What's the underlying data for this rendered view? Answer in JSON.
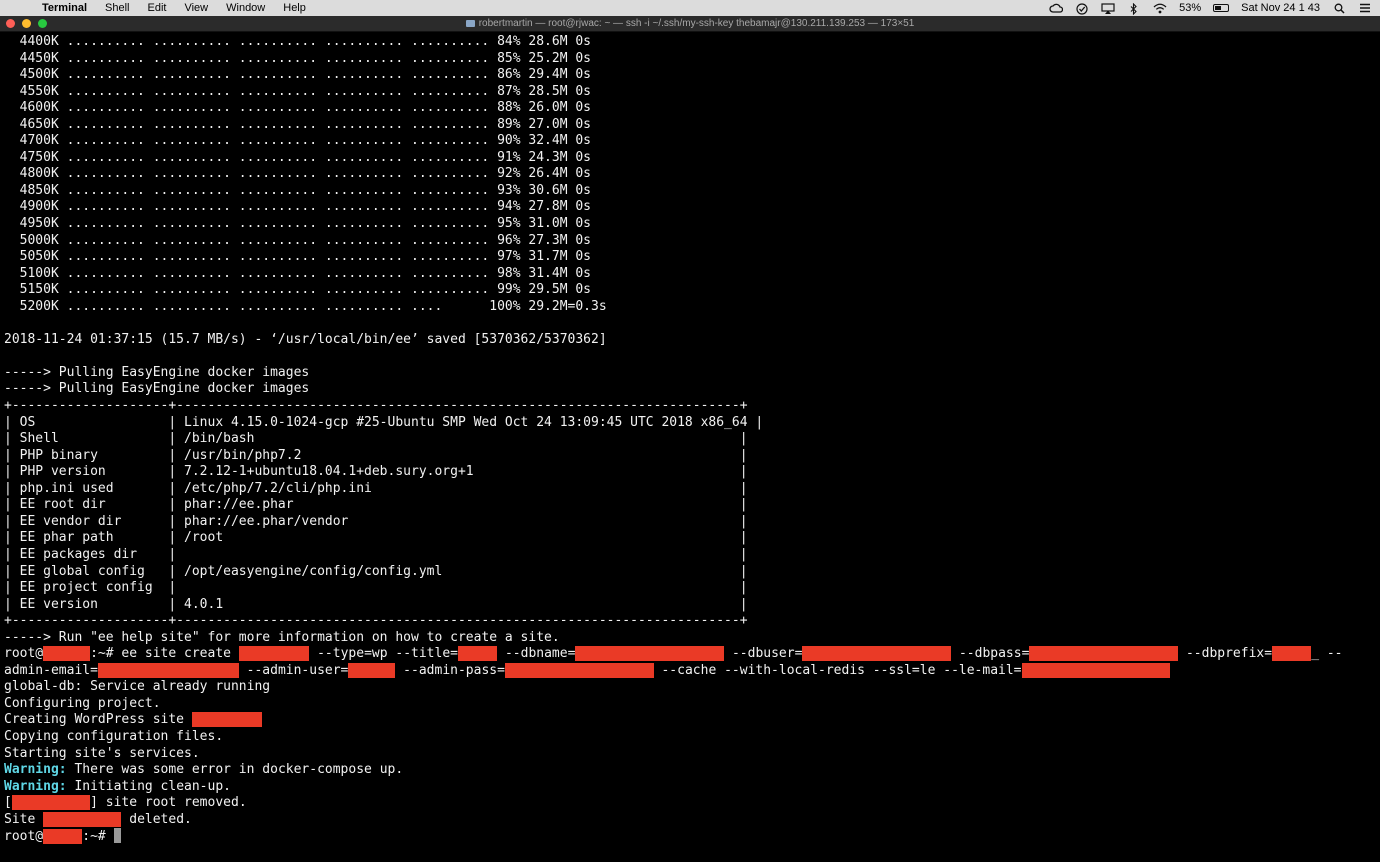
{
  "menubar": {
    "apple": "",
    "items": [
      "Terminal",
      "Shell",
      "Edit",
      "View",
      "Window",
      "Help"
    ],
    "battery_percent": "53%",
    "battery_level": 0.53,
    "clock": "Sat Nov 24  1 43",
    "icons": [
      "creative-cloud-icon",
      "check-icon",
      "airplay-icon",
      "bluetooth-icon",
      "wifi-icon",
      "battery-icon",
      "spotlight-icon",
      "notification-center-icon"
    ]
  },
  "window": {
    "title": "robertmartin — root@rjwac: ~ — ssh -i ~/.ssh/my-ssh-key thebamajr@130.211.139.253 — 173×51"
  },
  "terminal": {
    "lines": [
      [
        {
          "t": "  4400K .......... .......... .......... .......... .......... 84% 28.6M 0s"
        }
      ],
      [
        {
          "t": "  4450K .......... .......... .......... .......... .......... 85% 25.2M 0s"
        }
      ],
      [
        {
          "t": "  4500K .......... .......... .......... .......... .......... 86% 29.4M 0s"
        }
      ],
      [
        {
          "t": "  4550K .......... .......... .......... .......... .......... 87% 28.5M 0s"
        }
      ],
      [
        {
          "t": "  4600K .......... .......... .......... .......... .......... 88% 26.0M 0s"
        }
      ],
      [
        {
          "t": "  4650K .......... .......... .......... .......... .......... 89% 27.0M 0s"
        }
      ],
      [
        {
          "t": "  4700K .......... .......... .......... .......... .......... 90% 32.4M 0s"
        }
      ],
      [
        {
          "t": "  4750K .......... .......... .......... .......... .......... 91% 24.3M 0s"
        }
      ],
      [
        {
          "t": "  4800K .......... .......... .......... .......... .......... 92% 26.4M 0s"
        }
      ],
      [
        {
          "t": "  4850K .......... .......... .......... .......... .......... 93% 30.6M 0s"
        }
      ],
      [
        {
          "t": "  4900K .......... .......... .......... .......... .......... 94% 27.8M 0s"
        }
      ],
      [
        {
          "t": "  4950K .......... .......... .......... .......... .......... 95% 31.0M 0s"
        }
      ],
      [
        {
          "t": "  5000K .......... .......... .......... .......... .......... 96% 27.3M 0s"
        }
      ],
      [
        {
          "t": "  5050K .......... .......... .......... .......... .......... 97% 31.7M 0s"
        }
      ],
      [
        {
          "t": "  5100K .......... .......... .......... .......... .......... 98% 31.4M 0s"
        }
      ],
      [
        {
          "t": "  5150K .......... .......... .......... .......... .......... 99% 29.5M 0s"
        }
      ],
      [
        {
          "t": "  5200K .......... .......... .......... .......... ....      100% 29.2M=0.3s"
        }
      ],
      [],
      [
        {
          "t": "2018-11-24 01:37:15 (15.7 MB/s) - ‘/usr/local/bin/ee’ saved [5370362/5370362]"
        }
      ],
      [],
      [
        {
          "t": "-----> Pulling EasyEngine docker images"
        }
      ],
      [
        {
          "t": "-----> Pulling EasyEngine docker images"
        }
      ],
      [
        {
          "t": "+--------------------+------------------------------------------------------------------------+"
        }
      ],
      [
        {
          "t": "| OS                 | Linux 4.15.0-1024-gcp #25-Ubuntu SMP Wed Oct 24 13:09:45 UTC 2018 x86_64 |"
        }
      ],
      [
        {
          "t": "| Shell              | /bin/bash                                                              |"
        }
      ],
      [
        {
          "t": "| PHP binary         | /usr/bin/php7.2                                                        |"
        }
      ],
      [
        {
          "t": "| PHP version        | 7.2.12-1+ubuntu18.04.1+deb.sury.org+1                                  |"
        }
      ],
      [
        {
          "t": "| php.ini used       | /etc/php/7.2/cli/php.ini                                               |"
        }
      ],
      [
        {
          "t": "| EE root dir        | phar://ee.phar                                                         |"
        }
      ],
      [
        {
          "t": "| EE vendor dir      | phar://ee.phar/vendor                                                  |"
        }
      ],
      [
        {
          "t": "| EE phar path       | /root                                                                  |"
        }
      ],
      [
        {
          "t": "| EE packages dir    |                                                                        |"
        }
      ],
      [
        {
          "t": "| EE global config   | /opt/easyengine/config/config.yml                                      |"
        }
      ],
      [
        {
          "t": "| EE project config  |                                                                        |"
        }
      ],
      [
        {
          "t": "| EE version         | 4.0.1                                                                  |"
        }
      ],
      [
        {
          "t": "+--------------------+------------------------------------------------------------------------+"
        }
      ],
      [
        {
          "t": "-----> Run \"ee help site\" for more information on how to create a site."
        }
      ],
      [
        {
          "t": "root@"
        },
        {
          "t": "      ",
          "c": "red"
        },
        {
          "t": ":~# ee site create "
        },
        {
          "t": "         ",
          "c": "red"
        },
        {
          "t": " --type=wp --title="
        },
        {
          "t": "     ",
          "c": "red"
        },
        {
          "t": " --dbname="
        },
        {
          "t": "                   ",
          "c": "red"
        },
        {
          "t": " --dbuser="
        },
        {
          "t": "                   ",
          "c": "red"
        },
        {
          "t": " --dbpass="
        },
        {
          "t": "                   ",
          "c": "red"
        },
        {
          "t": " --dbprefix="
        },
        {
          "t": "     ",
          "c": "red"
        },
        {
          "t": "_ --"
        }
      ],
      [
        {
          "t": "admin-email="
        },
        {
          "t": "                  ",
          "c": "red"
        },
        {
          "t": " --admin-user="
        },
        {
          "t": "      ",
          "c": "red"
        },
        {
          "t": " --admin-pass="
        },
        {
          "t": "                   ",
          "c": "red"
        },
        {
          "t": " --cache --with-local-redis --ssl=le --le-mail="
        },
        {
          "t": "                   ",
          "c": "red"
        }
      ],
      [
        {
          "t": "global-db: Service already running"
        }
      ],
      [
        {
          "t": "Configuring project."
        }
      ],
      [
        {
          "t": "Creating WordPress site "
        },
        {
          "t": "         ",
          "c": "red"
        }
      ],
      [
        {
          "t": "Copying configuration files."
        }
      ],
      [
        {
          "t": "Starting site's services."
        }
      ],
      [
        {
          "t": "Warning:",
          "c": "warn"
        },
        {
          "t": " There was some error in docker-compose up."
        }
      ],
      [
        {
          "t": "Warning:",
          "c": "warn"
        },
        {
          "t": " Initiating clean-up."
        }
      ],
      [
        {
          "t": "["
        },
        {
          "t": "          ",
          "c": "red"
        },
        {
          "t": "] site root removed."
        }
      ],
      [
        {
          "t": "Site "
        },
        {
          "t": "          ",
          "c": "red"
        },
        {
          "t": " deleted."
        }
      ],
      [
        {
          "t": "root@"
        },
        {
          "t": "     ",
          "c": "red"
        },
        {
          "t": ":~# "
        }
      ]
    ]
  }
}
